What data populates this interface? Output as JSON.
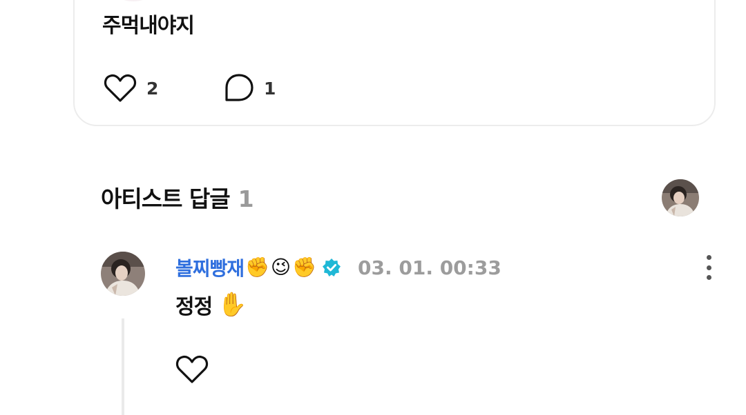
{
  "post": {
    "text": "주먹내야지",
    "like_count": "2",
    "comment_count": "1"
  },
  "artist_replies": {
    "title": "아티스트 답글",
    "count": "1"
  },
  "comment": {
    "author": "볼찌빵재",
    "author_emojis": [
      "✊",
      "😉",
      "✊"
    ],
    "timestamp": "03. 01. 00:33",
    "text": "정정",
    "text_emoji": "✋"
  },
  "colors": {
    "artist_name": "#2f6fde",
    "verified_badge": "#1fb8d6",
    "muted": "#9c9c9c"
  },
  "icons": [
    "heart-outline-icon",
    "speech-bubble-icon",
    "verified-badge-icon",
    "more-vertical-icon"
  ]
}
